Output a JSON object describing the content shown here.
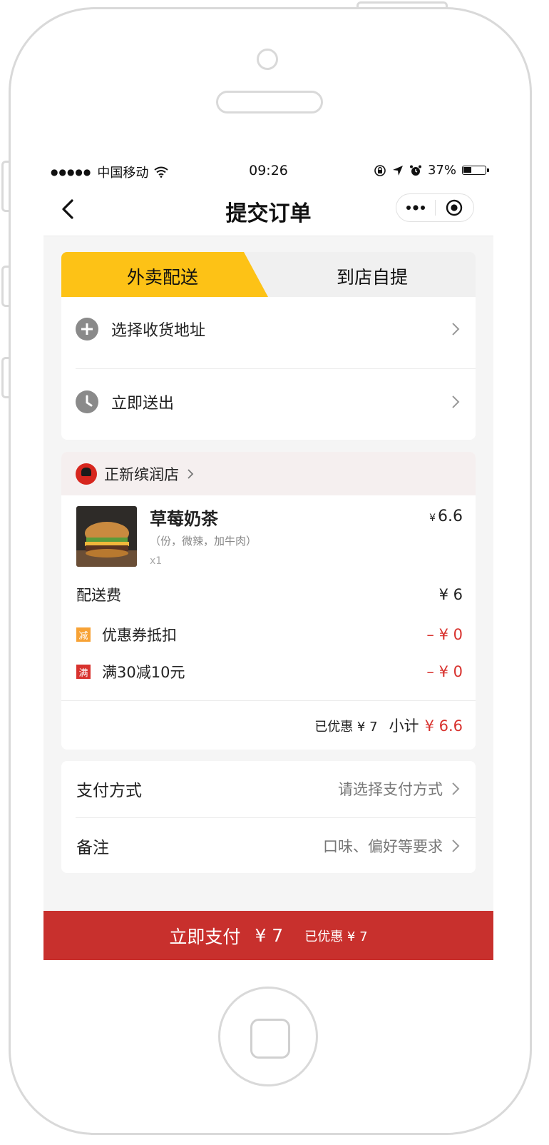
{
  "status_bar": {
    "signal_dots": "●●●●●",
    "carrier": "中国移动",
    "time": "09:26",
    "battery_text": "37%",
    "battery_level": 0.37
  },
  "nav": {
    "title": "提交订单",
    "more_icon": "more-dots-icon",
    "close_icon": "target-close-icon"
  },
  "delivery": {
    "tabs": [
      "外卖配送",
      "到店自提"
    ],
    "active_tab": 0,
    "active_color": "#fdc216",
    "rows": [
      {
        "icon": "plus-circle-icon",
        "label": "选择收货地址"
      },
      {
        "icon": "clock-icon",
        "label": "立即送出"
      }
    ]
  },
  "order": {
    "store_name": "正新缤润店",
    "item": {
      "name": "草莓奶茶",
      "spec": "（份，微辣，加牛肉）",
      "qty": "x1",
      "currency": "¥",
      "price": "6.6"
    },
    "delivery_fee_label": "配送费",
    "delivery_fee_value": "¥ 6",
    "discounts": [
      {
        "badge": "减",
        "label": "优惠券抵扣",
        "value": "– ¥ 0"
      },
      {
        "badge": "满",
        "label": "满30减10元",
        "value": "– ¥ 0"
      }
    ],
    "saved_text": "已优惠 ¥ 7",
    "subtotal_label": "小计",
    "subtotal_value": "¥ 6.6"
  },
  "payment": {
    "method_label": "支付方式",
    "method_value": "请选择支付方式",
    "note_label": "备注",
    "note_value": "口味、偏好等要求"
  },
  "pay_bar": {
    "label": "立即支付",
    "amount": "¥ 7",
    "saved": "已优惠 ¥ 7",
    "color": "#c8302d"
  }
}
